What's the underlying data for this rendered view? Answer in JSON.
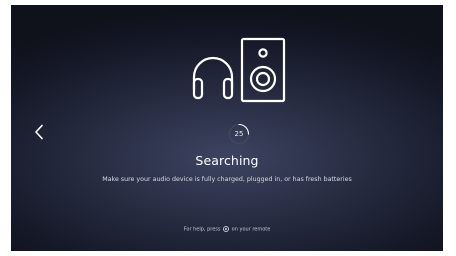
{
  "screen": {
    "icons": {
      "back": "chevron-left-icon",
      "headphones": "headphones-icon",
      "speaker": "speaker-icon",
      "remote_key": "remote-home-button-icon"
    },
    "countdown": {
      "value": "25",
      "progress_fraction": 0.25
    },
    "status": {
      "title": "Searching",
      "message": "Make sure your audio device is fully charged, plugged in, or has fresh batteries"
    },
    "help": {
      "before": "For help, press",
      "after": "on your remote"
    },
    "colors": {
      "text": "#ffffff",
      "background_center": "#3d4462",
      "background_edge": "#0f111b"
    }
  }
}
